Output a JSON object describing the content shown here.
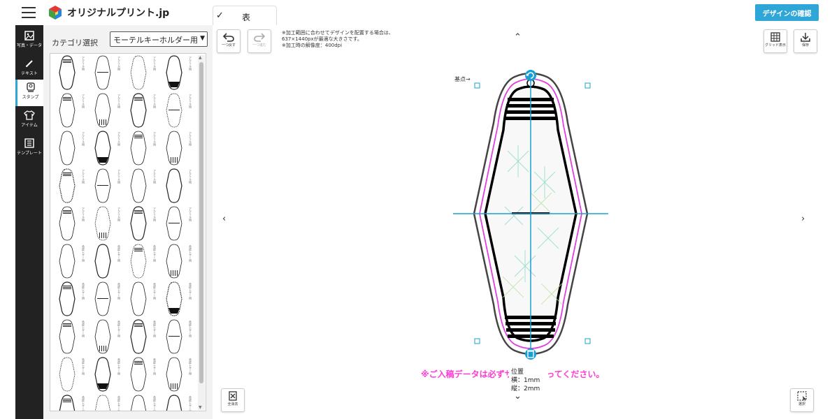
{
  "header": {
    "logo_text": "オリジナルプリント.jp",
    "tab_label": "表",
    "tab_check": "✓",
    "confirm_button": "デザインの確認"
  },
  "leftnav": {
    "items": [
      {
        "label": "写真・データ",
        "icon": "image-icon"
      },
      {
        "label": "テキスト",
        "icon": "pencil-icon"
      },
      {
        "label": "スタンプ",
        "icon": "stamp-icon",
        "active": true
      },
      {
        "label": "アイテム",
        "icon": "tshirt-icon"
      },
      {
        "label": "テンプレート",
        "icon": "template-icon"
      }
    ]
  },
  "panel": {
    "category_label": "カテゴリ選択",
    "category_value": "モーテルキーホルダー用",
    "thumb_captions": [
      "アクリル用",
      "合皮レザー用",
      "合皮レザー用",
      "合皮レザー用"
    ]
  },
  "canvas": {
    "undo_label": "一つ戻す",
    "redo_label": "一つ進む",
    "note_line1": "※加工範囲に合わせてデザインを配置する場合は、",
    "note_line2": "637×1440pxが最適な大きさです。",
    "note_line3": "※加工時の解像度：400dpi",
    "grid_label": "グリッド表示",
    "save_label": "保存",
    "clear_label": "全消去",
    "select_label": "選択",
    "origin_label": "基点→",
    "warning": "※ご入稿データは必ずサイズを行ってください。",
    "position_title": "位置",
    "position_x": "横：1mm",
    "position_y": "縦：2mm"
  },
  "colors": {
    "accent": "#2ea6d8",
    "warning": "#ff3bd4",
    "nav_bg": "#222222",
    "guide": "#1aa0d0",
    "cut_line": "#e040e0"
  }
}
